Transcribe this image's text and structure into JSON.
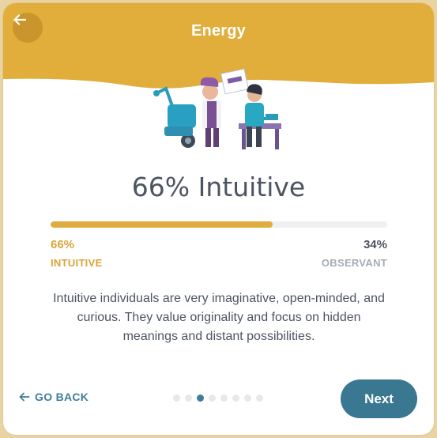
{
  "header": {
    "title": "Energy"
  },
  "result": {
    "headline": "66% Intuitive",
    "progress": 0.66,
    "left": {
      "percent": "66%",
      "label": "INTUITIVE"
    },
    "right": {
      "percent": "34%",
      "label": "OBSERVANT"
    },
    "description": "Intuitive individuals are very imaginative, open-minded, and curious. They value originality and focus on hidden meanings and distant possibilities."
  },
  "nav": {
    "go_back": "GO BACK",
    "next": "Next",
    "dots_total": 8,
    "dots_active": 2
  },
  "colors": {
    "accent": "#e1ac3f",
    "primary": "#3a7790",
    "text": "#4c5461",
    "muted": "#a6acb5"
  },
  "icons": {
    "back": "arrow-left-icon"
  }
}
